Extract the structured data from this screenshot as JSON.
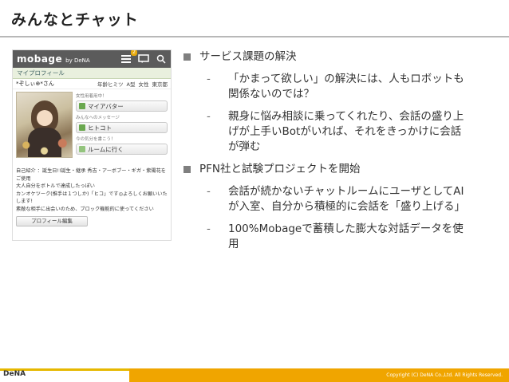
{
  "slide": {
    "title": "みんなとチャット"
  },
  "mobage": {
    "logo": "mobage",
    "logo_sub": "by DeNA",
    "badge_count": "2",
    "profile_header": "マイプロフィール",
    "user_name": "*ぞしぃ⊕*さん",
    "meta_age": "年齢ヒミツ",
    "meta_blood": "A型",
    "meta_gender": "女性",
    "meta_location": "東京都",
    "avatar_hint": "女性用着用中！",
    "cards": [
      {
        "label": "女性用着用中！",
        "title": "マイアバター",
        "color": "#6aa84f"
      },
      {
        "label": "みんなへのメッセージ",
        "title": "ヒトコト",
        "color": "#6aa84f"
      },
      {
        "label": "今の気分を書こう！",
        "title": "ルームに行く",
        "color": "#93c47d"
      }
    ],
    "intro_lines": [
      "自己紹介 ：誕生日!!誕生・継承 秀吉・アーボブー・ギガ・紫陽花をご使用",
      "大人自分をボトルで達成したっぽい",
      "カンオケツーク(推手は１つしか)「ヒコ」です◎よろしくお願いいたします!",
      "素敵な相手に出会いのため、ブロック機能的に使ってください"
    ],
    "edit_button": "プロフィール編集"
  },
  "bullets": [
    {
      "text": "サービス課題の解決",
      "subs": [
        "「かまって欲しい」の解決には、人もロボットも関係ないのでは？",
        "親身に悩み相談に乗ってくれたり、会話の盛り上げが上手いBotがいれば、それをきっかけに会話が弾む"
      ]
    },
    {
      "text": "PFN社と試験プロジェクトを開始",
      "subs": [
        "会話が続かないチャットルームにユーザとしてAIが入室、自分から積極的に会話を「盛り上げる」",
        "100%Mobageで蓄積した膨大な対話データを使用"
      ]
    }
  ],
  "footer": {
    "logo": "DeNA",
    "copyright": "Copyright (C) DeNA Co.,Ltd. All Rights Reserved."
  },
  "colors": {
    "accent": "#f0a500",
    "accent2": "#e6b800",
    "header_gray": "#5b5b5b"
  }
}
